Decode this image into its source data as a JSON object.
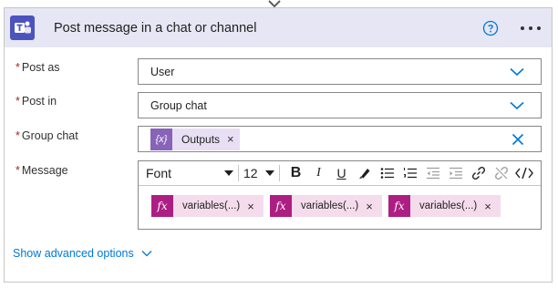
{
  "card": {
    "title": "Post message in a chat or channel",
    "icons": {
      "app": "teams-icon",
      "help": "help-icon",
      "more": "more-options-icon"
    }
  },
  "fields": {
    "post_as": {
      "label": "Post as",
      "value": "User"
    },
    "post_in": {
      "label": "Post in",
      "value": "Group chat"
    },
    "group_chat": {
      "label": "Group chat",
      "token": "Outputs",
      "token_remove": "×"
    },
    "message": {
      "label": "Message",
      "toolbar": {
        "font": "Font",
        "size": "12",
        "bold": "B",
        "italic": "I",
        "underline": "U"
      },
      "expressions": [
        {
          "text": "variables(...)",
          "icon": "fx",
          "remove": "×"
        },
        {
          "text": "variables(...)",
          "icon": "fx",
          "remove": "×"
        },
        {
          "text": "variables(...)",
          "icon": "fx",
          "remove": "×"
        }
      ]
    }
  },
  "required_marker": "*",
  "show_advanced": "Show advanced options",
  "colors": {
    "header_bg": "#e6e6f4",
    "teams_brand": "#4b53bc",
    "accent": "#0078d4",
    "required": "#a4262c",
    "dynamic_token": "#8764b8",
    "expression_token": "#ad1e83"
  }
}
